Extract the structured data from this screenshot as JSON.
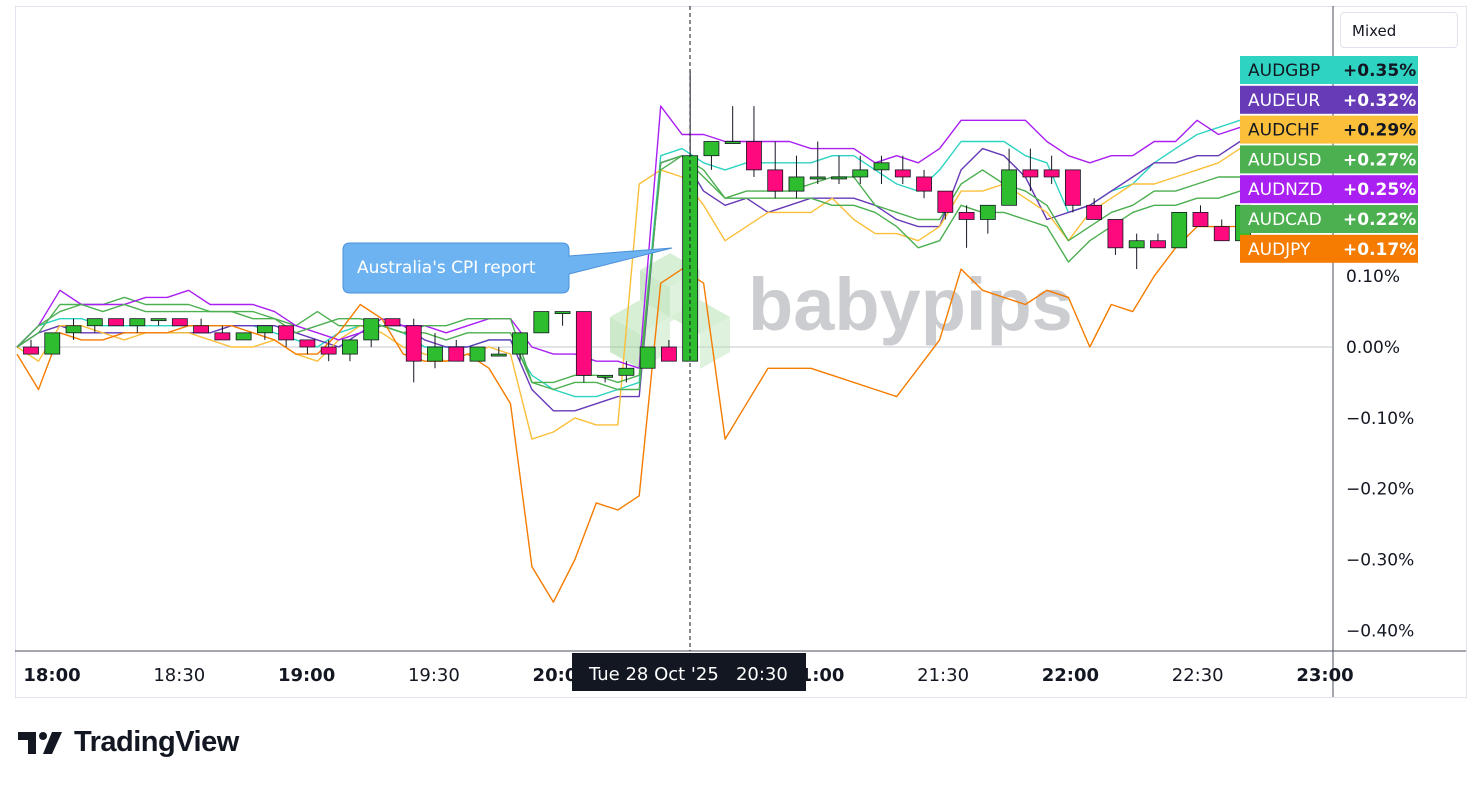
{
  "mode_button": "Mixed",
  "branding": {
    "platform": "TradingView",
    "watermark": "babypips"
  },
  "annotation": {
    "text": "Australia's CPI report"
  },
  "crosshair": {
    "label": "Tue 28 Oct '25   20:30"
  },
  "chart_data": {
    "type": "line",
    "xlim": [
      0,
      51
    ],
    "ylim": [
      -0.44,
      0.48
    ],
    "x_ticks": [
      {
        "label": "18:00",
        "x": 1
      },
      {
        "label": "18:30",
        "x": 7
      },
      {
        "label": "19:00",
        "x": 13
      },
      {
        "label": "19:30",
        "x": 19
      },
      {
        "label": "20:00",
        "x": 25
      },
      {
        "label": "21:00",
        "x": 37
      },
      {
        "label": "21:30",
        "x": 43
      },
      {
        "label": "22:00",
        "x": 49
      },
      {
        "label": "22:30",
        "x": 55
      },
      {
        "label": "23:00",
        "x": 61
      }
    ],
    "y_ticks": [
      {
        "label": "0.10%",
        "v": 0.1
      },
      {
        "label": "0.00%",
        "v": 0.0
      },
      {
        "label": "−0.10%",
        "v": -0.1
      },
      {
        "label": "−0.20%",
        "v": -0.2
      },
      {
        "label": "−0.30%",
        "v": -0.3
      },
      {
        "label": "−0.40%",
        "v": -0.4
      }
    ],
    "event_x": 31,
    "series": [
      {
        "name": "AUDGBP",
        "color": "#2ed3c2",
        "last": "+0.35%",
        "values": [
          0.0,
          0.03,
          0.04,
          0.04,
          0.03,
          0.03,
          0.03,
          0.03,
          0.03,
          0.03,
          0.03,
          0.03,
          0.02,
          0.01,
          0.0,
          0.02,
          0.03,
          0.03,
          0.02,
          0.0,
          0.0,
          0.0,
          0.01,
          0.01,
          -0.04,
          -0.06,
          -0.07,
          -0.07,
          -0.06,
          -0.05,
          0.27,
          0.28,
          0.26,
          0.25,
          0.26,
          0.26,
          0.26,
          0.26,
          0.27,
          0.27,
          0.25,
          0.23,
          0.22,
          0.25,
          0.29,
          0.29,
          0.29,
          0.27,
          0.26,
          0.19,
          0.2,
          0.22,
          0.23,
          0.26,
          0.28,
          0.3,
          0.31,
          0.32
        ]
      },
      {
        "name": "AUDEUR",
        "color": "#673ab7",
        "last": "+0.32%",
        "values": [
          0.0,
          0.02,
          0.03,
          0.02,
          0.02,
          0.02,
          0.02,
          0.02,
          0.02,
          0.02,
          0.03,
          0.03,
          0.03,
          0.02,
          0.01,
          0.0,
          0.02,
          0.03,
          0.03,
          0.01,
          0.0,
          0.0,
          0.01,
          0.01,
          -0.06,
          -0.09,
          -0.09,
          -0.08,
          -0.07,
          -0.07,
          0.26,
          0.27,
          0.22,
          0.2,
          0.21,
          0.19,
          0.2,
          0.21,
          0.21,
          0.21,
          0.2,
          0.18,
          0.17,
          0.17,
          0.25,
          0.28,
          0.27,
          0.24,
          0.18,
          0.19,
          0.2,
          0.22,
          0.24,
          0.26,
          0.26,
          0.27,
          0.27,
          0.29
        ]
      },
      {
        "name": "AUDCHF",
        "color": "#fbbf3a",
        "last": "+0.29%",
        "values": [
          0.0,
          -0.02,
          0.03,
          0.03,
          0.02,
          0.01,
          0.02,
          0.02,
          0.02,
          0.01,
          0.0,
          0.0,
          0.01,
          -0.01,
          -0.02,
          0.01,
          0.03,
          0.02,
          0.0,
          -0.01,
          -0.02,
          -0.01,
          0.0,
          -0.01,
          -0.13,
          -0.12,
          -0.1,
          -0.11,
          -0.11,
          0.23,
          0.25,
          0.24,
          0.2,
          0.15,
          0.17,
          0.19,
          0.19,
          0.19,
          0.21,
          0.18,
          0.16,
          0.16,
          0.15,
          0.17,
          0.22,
          0.22,
          0.23,
          0.21,
          0.19,
          0.15,
          0.19,
          0.21,
          0.23,
          0.23,
          0.24,
          0.25,
          0.26,
          0.28
        ]
      },
      {
        "name": "AUDUSD",
        "color": "#4caf50",
        "last": "+0.27%",
        "values": [
          0.0,
          0.02,
          0.06,
          0.06,
          0.06,
          0.07,
          0.06,
          0.06,
          0.06,
          0.05,
          0.05,
          0.05,
          0.04,
          0.03,
          0.05,
          0.03,
          0.03,
          0.03,
          0.02,
          0.02,
          0.01,
          0.02,
          0.02,
          0.02,
          -0.05,
          -0.06,
          -0.05,
          -0.05,
          -0.06,
          -0.06,
          0.26,
          0.27,
          0.24,
          0.21,
          0.22,
          0.22,
          0.22,
          0.23,
          0.24,
          0.24,
          0.2,
          0.19,
          0.18,
          0.18,
          0.23,
          0.25,
          0.23,
          0.22,
          0.2,
          0.15,
          0.17,
          0.19,
          0.2,
          0.22,
          0.22,
          0.23,
          0.24,
          0.24
        ]
      },
      {
        "name": "AUDNZD",
        "color": "#aa1ff2",
        "last": "+0.25%",
        "values": [
          0.0,
          0.03,
          0.08,
          0.06,
          0.06,
          0.06,
          0.07,
          0.07,
          0.08,
          0.06,
          0.06,
          0.06,
          0.05,
          0.03,
          0.02,
          0.01,
          0.02,
          0.04,
          0.03,
          0.03,
          0.02,
          0.03,
          0.04,
          0.04,
          0.0,
          -0.01,
          -0.01,
          -0.02,
          -0.02,
          -0.03,
          0.34,
          0.3,
          0.3,
          0.29,
          0.29,
          0.29,
          0.29,
          0.28,
          0.28,
          0.28,
          0.26,
          0.27,
          0.26,
          0.28,
          0.32,
          0.32,
          0.32,
          0.32,
          0.29,
          0.27,
          0.26,
          0.27,
          0.27,
          0.29,
          0.29,
          0.32,
          0.3,
          0.31
        ]
      },
      {
        "name": "AUDCAD",
        "color": "#4caf50",
        "last": "+0.22%",
        "values": [
          0.0,
          0.03,
          0.05,
          0.06,
          0.05,
          0.06,
          0.05,
          0.05,
          0.05,
          0.05,
          0.05,
          0.04,
          0.04,
          0.02,
          0.03,
          0.04,
          0.04,
          0.03,
          0.02,
          0.03,
          0.03,
          0.04,
          0.04,
          0.04,
          -0.05,
          -0.05,
          -0.04,
          -0.04,
          -0.05,
          -0.04,
          0.25,
          0.27,
          0.25,
          0.21,
          0.21,
          0.21,
          0.21,
          0.21,
          0.2,
          0.2,
          0.19,
          0.17,
          0.14,
          0.15,
          0.2,
          0.19,
          0.19,
          0.18,
          0.17,
          0.12,
          0.15,
          0.17,
          0.19,
          0.2,
          0.2,
          0.21,
          0.21,
          0.22
        ]
      },
      {
        "name": "AUDJPY",
        "color": "#f57c00",
        "last": "+0.17%",
        "values": [
          -0.01,
          -0.06,
          0.02,
          0.01,
          0.01,
          0.02,
          0.02,
          0.02,
          0.03,
          0.03,
          0.03,
          0.02,
          0.01,
          -0.01,
          -0.01,
          0.02,
          0.06,
          0.04,
          -0.01,
          -0.02,
          -0.02,
          -0.01,
          -0.03,
          -0.08,
          -0.31,
          -0.36,
          -0.3,
          -0.22,
          -0.23,
          -0.21,
          0.09,
          0.11,
          0.09,
          -0.13,
          -0.08,
          -0.03,
          -0.03,
          -0.03,
          -0.04,
          -0.05,
          -0.06,
          -0.07,
          -0.03,
          0.01,
          0.11,
          0.08,
          0.07,
          0.06,
          0.08,
          0.07,
          0.0,
          0.06,
          0.05,
          0.1,
          0.14,
          0.17,
          0.17,
          0.17
        ]
      }
    ],
    "candles": [
      {
        "o": 0.0,
        "h": 0.01,
        "l": -0.01,
        "c": -0.01
      },
      {
        "o": -0.01,
        "h": 0.02,
        "l": -0.01,
        "c": 0.02
      },
      {
        "o": 0.02,
        "h": 0.04,
        "l": 0.01,
        "c": 0.03
      },
      {
        "o": 0.03,
        "h": 0.04,
        "l": 0.02,
        "c": 0.04
      },
      {
        "o": 0.04,
        "h": 0.04,
        "l": 0.03,
        "c": 0.03
      },
      {
        "o": 0.03,
        "h": 0.04,
        "l": 0.02,
        "c": 0.04
      },
      {
        "o": 0.04,
        "h": 0.04,
        "l": 0.03,
        "c": 0.04
      },
      {
        "o": 0.04,
        "h": 0.04,
        "l": 0.03,
        "c": 0.03
      },
      {
        "o": 0.03,
        "h": 0.04,
        "l": 0.02,
        "c": 0.02
      },
      {
        "o": 0.02,
        "h": 0.03,
        "l": 0.01,
        "c": 0.01
      },
      {
        "o": 0.01,
        "h": 0.02,
        "l": 0.01,
        "c": 0.02
      },
      {
        "o": 0.02,
        "h": 0.03,
        "l": 0.01,
        "c": 0.03
      },
      {
        "o": 0.03,
        "h": 0.03,
        "l": 0.0,
        "c": 0.01
      },
      {
        "o": 0.01,
        "h": 0.01,
        "l": -0.01,
        "c": 0.0
      },
      {
        "o": 0.0,
        "h": 0.01,
        "l": -0.02,
        "c": -0.01
      },
      {
        "o": -0.01,
        "h": 0.01,
        "l": -0.02,
        "c": 0.01
      },
      {
        "o": 0.01,
        "h": 0.04,
        "l": 0.0,
        "c": 0.04
      },
      {
        "o": 0.04,
        "h": 0.04,
        "l": 0.03,
        "c": 0.03
      },
      {
        "o": 0.03,
        "h": 0.04,
        "l": -0.05,
        "c": -0.02
      },
      {
        "o": -0.02,
        "h": 0.02,
        "l": -0.03,
        "c": 0.0
      },
      {
        "o": 0.0,
        "h": 0.01,
        "l": -0.02,
        "c": -0.02
      },
      {
        "o": -0.02,
        "h": 0.0,
        "l": -0.02,
        "c": 0.0
      },
      {
        "o": -0.01,
        "h": 0.0,
        "l": -0.01,
        "c": -0.01
      },
      {
        "o": -0.01,
        "h": 0.02,
        "l": -0.02,
        "c": 0.02
      },
      {
        "o": 0.02,
        "h": 0.05,
        "l": 0.02,
        "c": 0.05
      },
      {
        "o": 0.05,
        "h": 0.05,
        "l": 0.03,
        "c": 0.05
      },
      {
        "o": 0.05,
        "h": 0.05,
        "l": -0.05,
        "c": -0.04
      },
      {
        "o": -0.04,
        "h": -0.04,
        "l": -0.05,
        "c": -0.04
      },
      {
        "o": -0.04,
        "h": -0.02,
        "l": -0.05,
        "c": -0.03
      },
      {
        "o": -0.03,
        "h": 0.0,
        "l": -0.03,
        "c": 0.0
      },
      {
        "o": 0.0,
        "h": 0.01,
        "l": -0.02,
        "c": -0.02
      },
      {
        "o": -0.02,
        "h": 0.39,
        "l": -0.02,
        "c": 0.27
      },
      {
        "o": 0.27,
        "h": 0.29,
        "l": 0.25,
        "c": 0.29
      },
      {
        "o": 0.29,
        "h": 0.34,
        "l": 0.29,
        "c": 0.29
      },
      {
        "o": 0.29,
        "h": 0.34,
        "l": 0.24,
        "c": 0.25
      },
      {
        "o": 0.25,
        "h": 0.29,
        "l": 0.21,
        "c": 0.22
      },
      {
        "o": 0.22,
        "h": 0.27,
        "l": 0.21,
        "c": 0.24
      },
      {
        "o": 0.24,
        "h": 0.29,
        "l": 0.23,
        "c": 0.24
      },
      {
        "o": 0.24,
        "h": 0.27,
        "l": 0.23,
        "c": 0.24
      },
      {
        "o": 0.24,
        "h": 0.27,
        "l": 0.23,
        "c": 0.25
      },
      {
        "o": 0.25,
        "h": 0.27,
        "l": 0.23,
        "c": 0.26
      },
      {
        "o": 0.25,
        "h": 0.27,
        "l": 0.23,
        "c": 0.24
      },
      {
        "o": 0.24,
        "h": 0.25,
        "l": 0.21,
        "c": 0.22
      },
      {
        "o": 0.22,
        "h": 0.22,
        "l": 0.18,
        "c": 0.19
      },
      {
        "o": 0.19,
        "h": 0.2,
        "l": 0.14,
        "c": 0.18
      },
      {
        "o": 0.18,
        "h": 0.2,
        "l": 0.16,
        "c": 0.2
      },
      {
        "o": 0.2,
        "h": 0.28,
        "l": 0.2,
        "c": 0.25
      },
      {
        "o": 0.25,
        "h": 0.28,
        "l": 0.22,
        "c": 0.24
      },
      {
        "o": 0.25,
        "h": 0.27,
        "l": 0.23,
        "c": 0.24
      },
      {
        "o": 0.25,
        "h": 0.25,
        "l": 0.19,
        "c": 0.2
      },
      {
        "o": 0.2,
        "h": 0.21,
        "l": 0.18,
        "c": 0.18
      },
      {
        "o": 0.18,
        "h": 0.18,
        "l": 0.13,
        "c": 0.14
      },
      {
        "o": 0.14,
        "h": 0.16,
        "l": 0.11,
        "c": 0.15
      },
      {
        "o": 0.15,
        "h": 0.16,
        "l": 0.14,
        "c": 0.14
      },
      {
        "o": 0.14,
        "h": 0.19,
        "l": 0.14,
        "c": 0.19
      },
      {
        "o": 0.19,
        "h": 0.2,
        "l": 0.17,
        "c": 0.17
      },
      {
        "o": 0.17,
        "h": 0.18,
        "l": 0.15,
        "c": 0.15
      },
      {
        "o": 0.15,
        "h": 0.2,
        "l": 0.14,
        "c": 0.2
      }
    ]
  }
}
